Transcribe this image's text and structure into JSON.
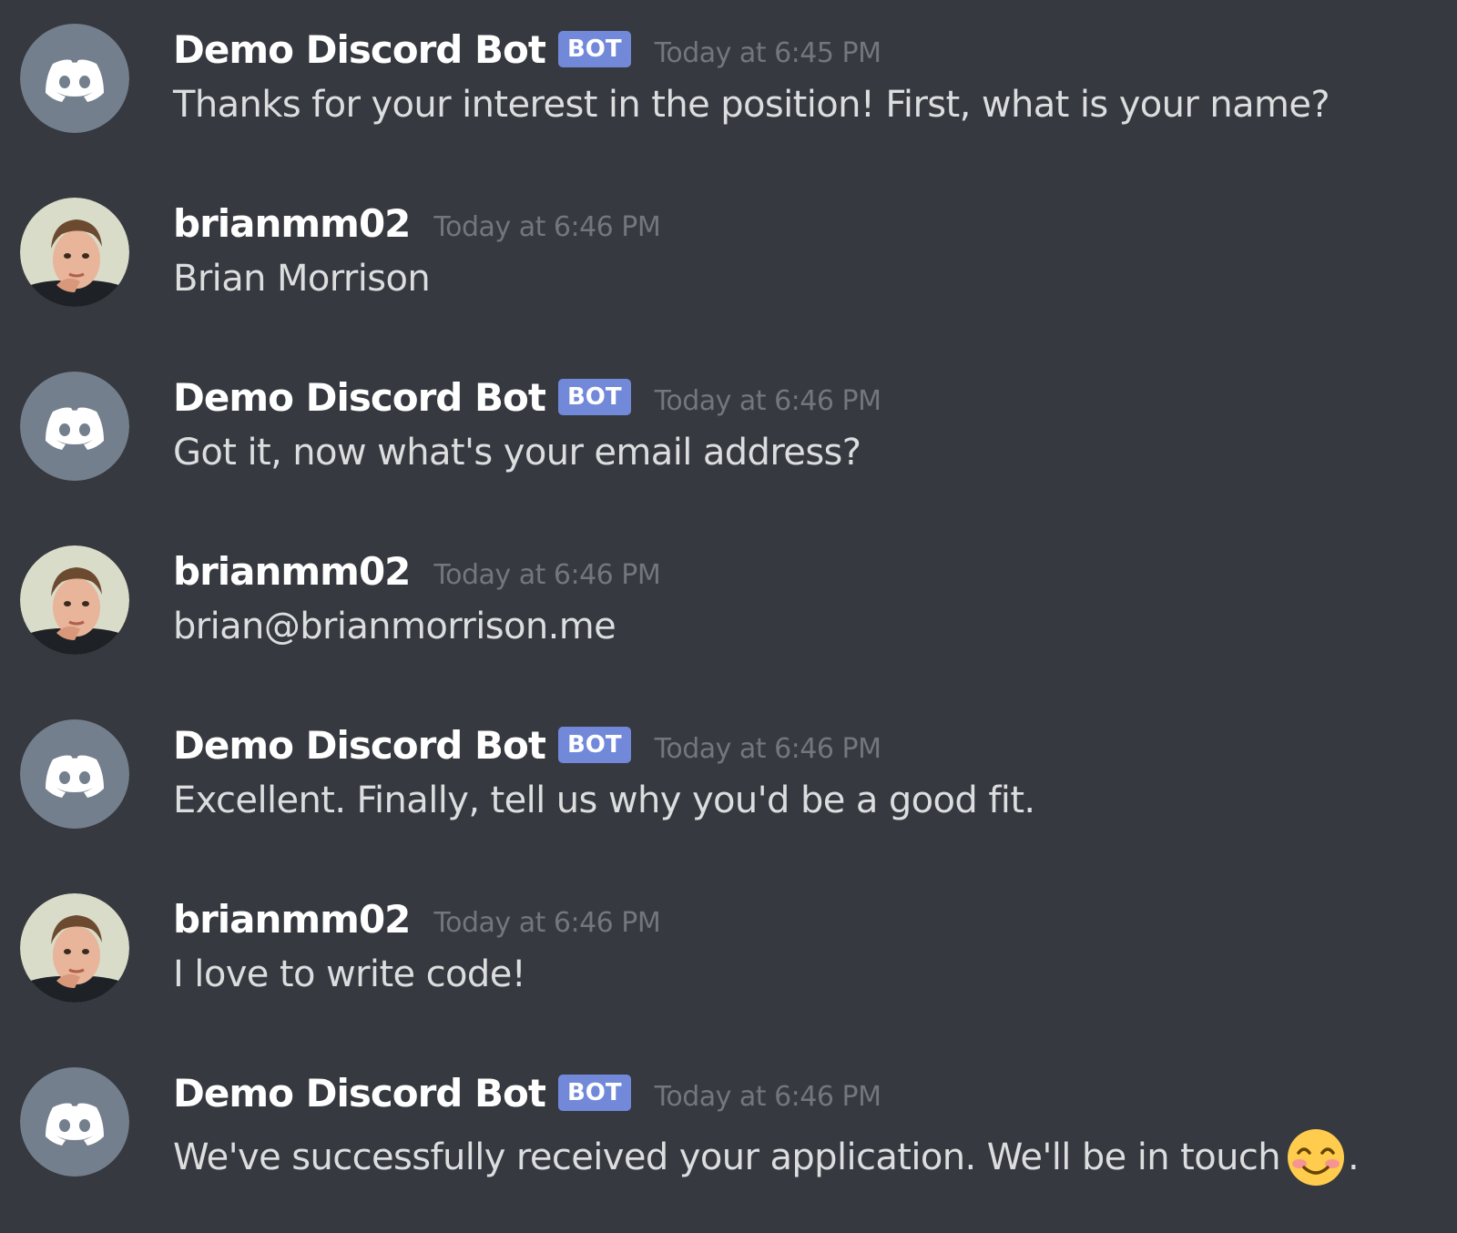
{
  "messages": [
    {
      "author": "Demo Discord Bot",
      "is_bot": true,
      "bot_tag": "BOT",
      "timestamp": "Today at 6:45 PM",
      "text": "Thanks for your interest in the position! First, what is your name?",
      "avatar_icon": "discord-logo-icon"
    },
    {
      "author": "brianmm02",
      "is_bot": false,
      "timestamp": "Today at 6:46 PM",
      "text": "Brian Morrison",
      "avatar_icon": "user-photo"
    },
    {
      "author": "Demo Discord Bot",
      "is_bot": true,
      "bot_tag": "BOT",
      "timestamp": "Today at 6:46 PM",
      "text": "Got it, now what's your email address?",
      "avatar_icon": "discord-logo-icon"
    },
    {
      "author": "brianmm02",
      "is_bot": false,
      "timestamp": "Today at 6:46 PM",
      "text": "brian@brianmorrison.me",
      "avatar_icon": "user-photo"
    },
    {
      "author": "Demo Discord Bot",
      "is_bot": true,
      "bot_tag": "BOT",
      "timestamp": "Today at 6:46 PM",
      "text": "Excellent. Finally, tell us why you'd be a good fit.",
      "avatar_icon": "discord-logo-icon"
    },
    {
      "author": "brianmm02",
      "is_bot": false,
      "timestamp": "Today at 6:46 PM",
      "text": "I love to write code!",
      "avatar_icon": "user-photo"
    },
    {
      "author": "Demo Discord Bot",
      "is_bot": true,
      "bot_tag": "BOT",
      "timestamp": "Today at 6:46 PM",
      "text": "We've successfully received your application. We'll be in touch",
      "text_suffix": ".",
      "emoji": "smiling-face-emoji",
      "avatar_icon": "discord-logo-icon"
    }
  ],
  "colors": {
    "background": "#36393f",
    "username": "#ffffff",
    "message_text": "#dcddde",
    "timestamp": "#72767d",
    "bot_tag": "#7289da",
    "bot_avatar_bg": "#747f8d"
  }
}
